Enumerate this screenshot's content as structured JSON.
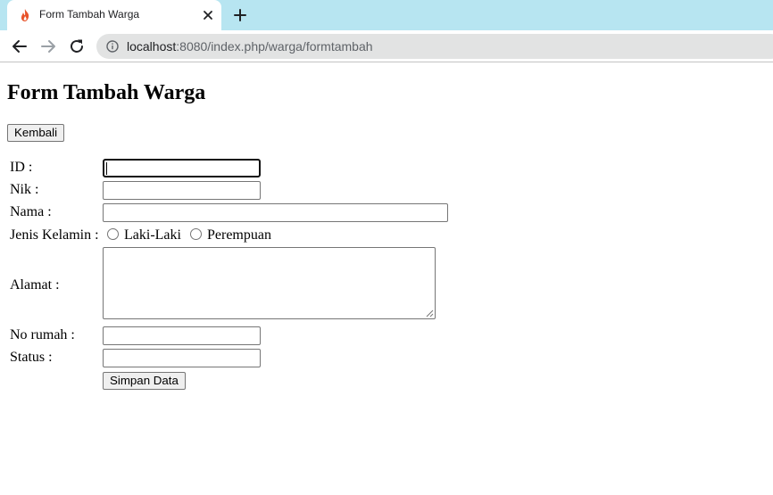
{
  "browser": {
    "tab_title": "Form Tambah Warga",
    "url_host": "localhost",
    "url_path": ":8080/index.php/warga/formtambah",
    "favicon": "flame-icon"
  },
  "page": {
    "title": "Form Tambah Warga",
    "back_button": "Kembali"
  },
  "form": {
    "id_label": "ID :",
    "id_value": "",
    "nik_label": "Nik :",
    "nik_value": "",
    "nama_label": "Nama :",
    "nama_value": "",
    "gender_label": "Jenis Kelamin :",
    "gender_options": [
      "Laki-Laki",
      "Perempuan"
    ],
    "alamat_label": "Alamat :",
    "alamat_value": "",
    "norumah_label": "No rumah :",
    "norumah_value": "",
    "status_label": "Status :",
    "status_value": "",
    "submit_button": "Simpan Data"
  }
}
